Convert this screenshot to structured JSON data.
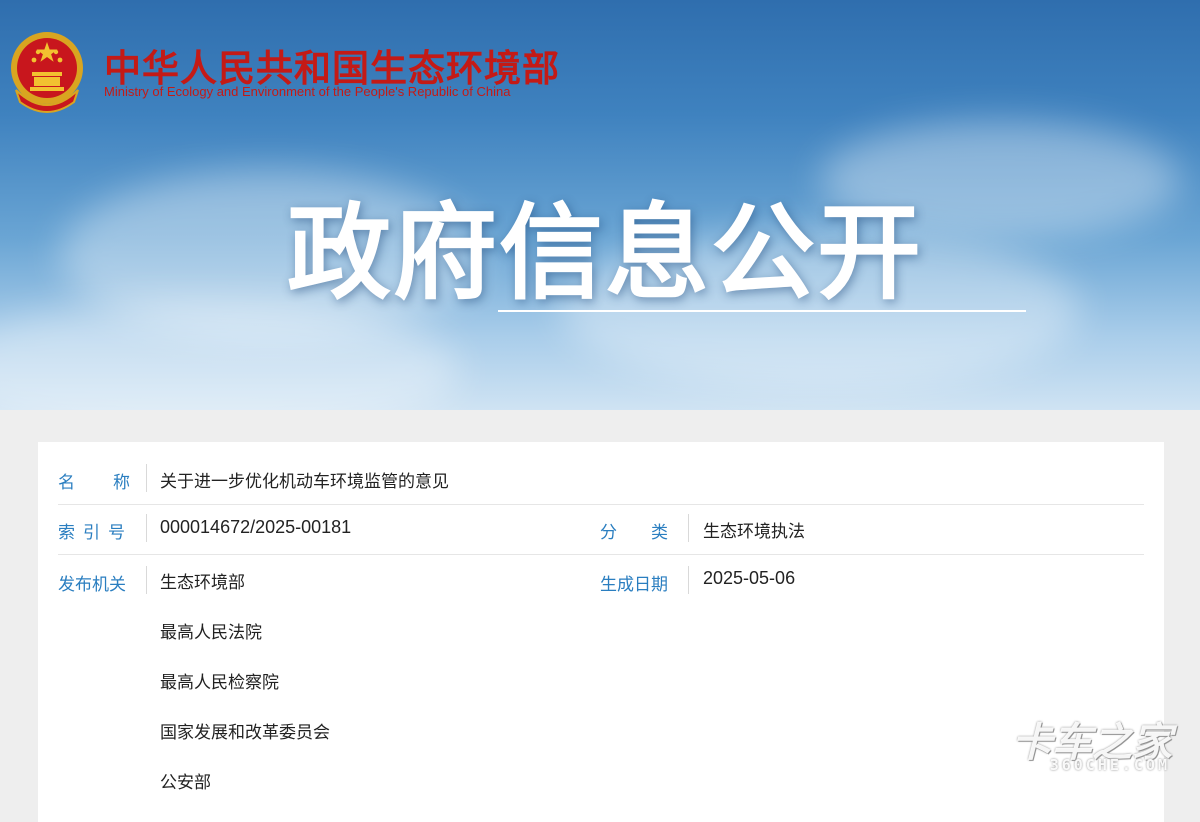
{
  "header": {
    "org_name_cn": "中华人民共和国生态环境部",
    "org_name_en": "Ministry of Ecology and Environment of the People's Republic of China",
    "emblem_icon": "national-emblem-icon",
    "banner_title": "政府信息公开"
  },
  "info": {
    "name_label": "名称",
    "name_value": "关于进一步优化机动车环境监管的意见",
    "index_label": "索引号",
    "index_value": "000014672/2025-00181",
    "category_label": "分类",
    "category_value": "生态环境执法",
    "publisher_label": "发布机关",
    "publishers": [
      "生态环境部",
      "最高人民法院",
      "最高人民检察院",
      "国家发展和改革委员会",
      "公安部"
    ],
    "date_label": "生成日期",
    "date_value": "2025-05-06"
  },
  "watermark": {
    "text_cn": "卡车之家",
    "text_en": "360CHE.COM"
  },
  "colors": {
    "org_red": "#c41a16",
    "label_blue": "#2a7ec0",
    "value_text": "#222222"
  }
}
